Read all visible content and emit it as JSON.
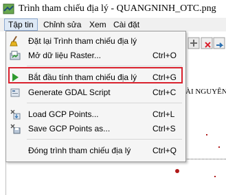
{
  "window": {
    "title": "Trình tham chiếu địa lý - QUANGNINH_OTC.png"
  },
  "menubar": {
    "items": [
      "Tập tin",
      "Chỉnh sửa",
      "Xem",
      "Cài đặt"
    ]
  },
  "file_menu": {
    "items": [
      {
        "label": "Đặt lại Trình tham chiếu địa lý",
        "shortcut": "",
        "icon": "broom-icon"
      },
      {
        "label": "Mở dữ liệu Raster...",
        "shortcut": "Ctrl+O",
        "icon": "open-raster-icon"
      },
      {
        "label": "Bắt đầu tính tham chiếu địa lý",
        "shortcut": "Ctrl+G",
        "icon": "play-icon",
        "highlighted": true
      },
      {
        "label": "Generate GDAL Script",
        "shortcut": "Ctrl+C",
        "icon": "script-icon"
      },
      {
        "label": "Load GCP Points...",
        "shortcut": "Ctrl+L",
        "icon": "load-gcp-icon"
      },
      {
        "label": "Save GCP Points as...",
        "shortcut": "Ctrl+S",
        "icon": "save-gcp-icon"
      },
      {
        "label": "Đóng trình tham chiếu địa lý",
        "shortcut": "Ctrl+Q",
        "icon": ""
      }
    ]
  },
  "map": {
    "fragment_text": "ÀI NGUYÊN"
  },
  "colors": {
    "highlight_border": "#d9202c",
    "menu_bg": "#f5f5f5",
    "play_green": "#2e9a2e"
  }
}
